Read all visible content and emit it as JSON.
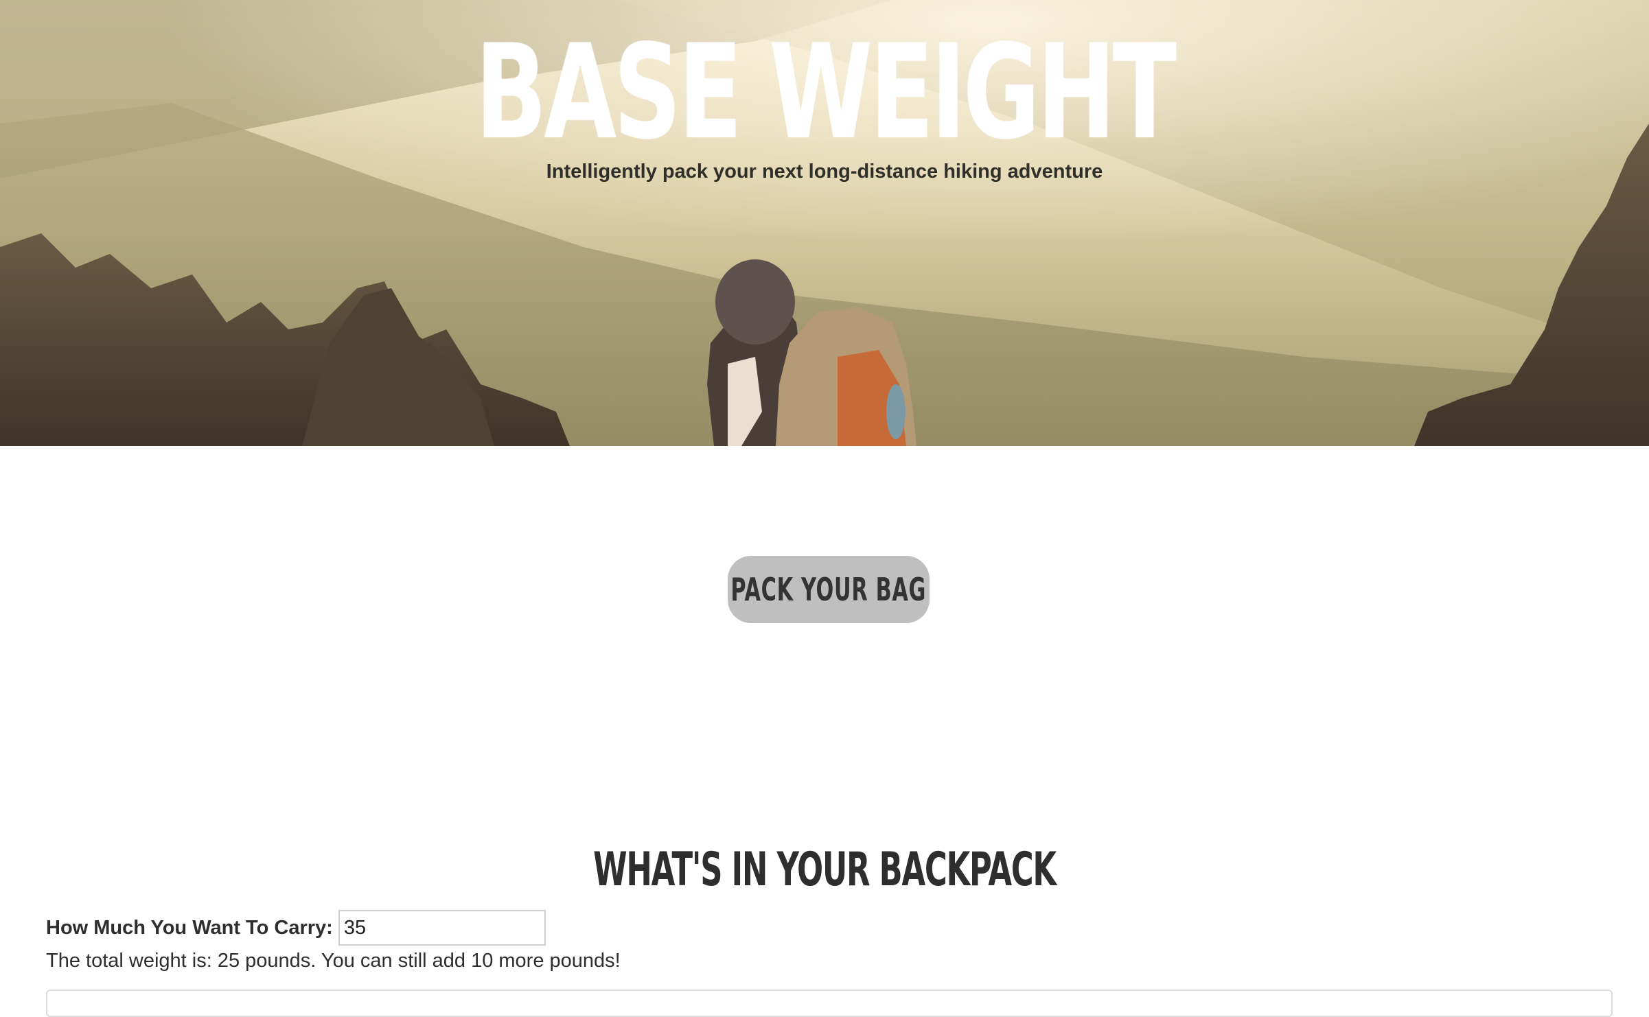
{
  "hero": {
    "title": "BASE WEIGHT",
    "subtitle": "Intelligently pack your next long-distance hiking adventure",
    "image": "hiker-with-backpack-mountain-photo"
  },
  "pack_button": {
    "label": "PACK YOUR BAG"
  },
  "backpack": {
    "title": "WHAT'S IN YOUR BACKPACK",
    "carry_label": "How Much You Want To Carry:",
    "carry_value": "35",
    "total_weight_text": "The total weight is: 25 pounds. You can still add 10 more pounds!"
  },
  "colors": {
    "button_bg": "#bfbfbf",
    "text_dark": "#333333",
    "hero_text": "#ffffff"
  }
}
